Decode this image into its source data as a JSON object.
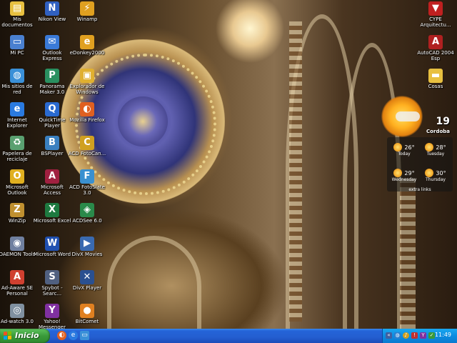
{
  "desktop": {
    "icons_left": [
      {
        "label": "Mis documentos",
        "icon": "folder-documents-icon",
        "color": "#e8c040",
        "glyph": "▤"
      },
      {
        "label": "Mi PC",
        "icon": "computer-icon",
        "color": "#4a80d0",
        "glyph": "▭"
      },
      {
        "label": "Mis sitios de red",
        "icon": "network-icon",
        "color": "#3a90d8",
        "glyph": "◍"
      },
      {
        "label": "Internet Explorer",
        "icon": "internet-explorer-icon",
        "color": "#2a7ae0",
        "glyph": "e"
      },
      {
        "label": "Papelera de reciclaje",
        "icon": "recycle-bin-icon",
        "color": "#5aa070",
        "glyph": "♻"
      },
      {
        "label": "Microsoft Outlook",
        "icon": "outlook-icon",
        "color": "#e0b020",
        "glyph": "O"
      },
      {
        "label": "WinZip",
        "icon": "winzip-icon",
        "color": "#c09030",
        "glyph": "Z"
      },
      {
        "label": "DAEMON Tools",
        "icon": "daemon-tools-icon",
        "color": "#7080a0",
        "glyph": "◉"
      },
      {
        "label": "Ad-Aware SE Personal",
        "icon": "ad-aware-icon",
        "color": "#d04030",
        "glyph": "A"
      },
      {
        "label": "Ad-watch 3.0",
        "icon": "ad-watch-icon",
        "color": "#8090a0",
        "glyph": "◎"
      }
    ],
    "icons_mid": [
      {
        "label": "Nikon View",
        "icon": "nikon-view-icon",
        "color": "#3060c0",
        "glyph": "N"
      },
      {
        "label": "Outlook Express",
        "icon": "outlook-express-icon",
        "color": "#3a7ad8",
        "glyph": "✉"
      },
      {
        "label": "Panorama Maker 3.0",
        "icon": "panorama-maker-icon",
        "color": "#2a9060",
        "glyph": "P"
      },
      {
        "label": "QuickTime Player",
        "icon": "quicktime-icon",
        "color": "#2a6ad0",
        "glyph": "Q"
      },
      {
        "label": "BSPlayer",
        "icon": "bsplayer-icon",
        "color": "#3a80c0",
        "glyph": "B"
      },
      {
        "label": "Microsoft Access",
        "icon": "access-icon",
        "color": "#a02040",
        "glyph": "A"
      },
      {
        "label": "Microsoft Excel",
        "icon": "excel-icon",
        "color": "#1e7a40",
        "glyph": "X"
      },
      {
        "label": "Microsoft Word",
        "icon": "word-icon",
        "color": "#2050b0",
        "glyph": "W"
      },
      {
        "label": "Spybot - Searc...",
        "icon": "spybot-icon",
        "color": "#506080",
        "glyph": "S"
      },
      {
        "label": "Yahoo! Messenger",
        "icon": "yahoo-messenger-icon",
        "color": "#8030a0",
        "glyph": "Y"
      }
    ],
    "icons_right_col": [
      {
        "label": "Winamp",
        "icon": "winamp-icon",
        "color": "#e0a020",
        "glyph": "⚡"
      },
      {
        "label": "eDonkey2000",
        "icon": "edonkey-icon",
        "color": "#e0a020",
        "glyph": "e"
      },
      {
        "label": "Explorador de Windows",
        "icon": "windows-explorer-icon",
        "color": "#e0b030",
        "glyph": "▣"
      },
      {
        "label": "Mozilla Firefox",
        "icon": "firefox-icon",
        "color": "#e06020",
        "glyph": "◐"
      },
      {
        "label": "ACD FotoCan...",
        "icon": "acd-fotocanvas-icon",
        "color": "#d0a020",
        "glyph": "C"
      },
      {
        "label": "ACD FotoSlate 3.0",
        "icon": "acd-fotoslate-icon",
        "color": "#3a90d0",
        "glyph": "F"
      },
      {
        "label": "ACDSee 6.0",
        "icon": "acdsee-icon",
        "color": "#2a8a4a",
        "glyph": "◈"
      },
      {
        "label": "DivX Movies",
        "icon": "divx-movies-icon",
        "color": "#3a6ab0",
        "glyph": "▶"
      },
      {
        "label": "DivX Player",
        "icon": "divx-player-icon",
        "color": "#2a5090",
        "glyph": "✕"
      },
      {
        "label": "BitComet",
        "icon": "bitcomet-icon",
        "color": "#e08020",
        "glyph": "●"
      }
    ],
    "icons_far_right": [
      {
        "label": "CYPE Arquitectu...",
        "icon": "cype-icon",
        "color": "#c02020",
        "glyph": "▼"
      },
      {
        "label": "AutoCAD 2004 Esp",
        "icon": "autocad-icon",
        "color": "#b02020",
        "glyph": "A"
      },
      {
        "label": "Cosas",
        "icon": "folder-icon",
        "color": "#e8c040",
        "glyph": "▬"
      }
    ]
  },
  "weather": {
    "current_temp": "19",
    "city": "Cordoba",
    "forecast": [
      {
        "temp": "26°",
        "day": "Today"
      },
      {
        "temp": "28°",
        "day": "Tuesday"
      },
      {
        "temp": "29°",
        "day": "Wednesday"
      },
      {
        "temp": "30°",
        "day": "Thursday"
      }
    ],
    "extra_label": "extra links"
  },
  "taskbar": {
    "start_label": "Inicio",
    "clock": "11:49",
    "accent": "#245ed0",
    "start_color": "#3a9a3a"
  }
}
